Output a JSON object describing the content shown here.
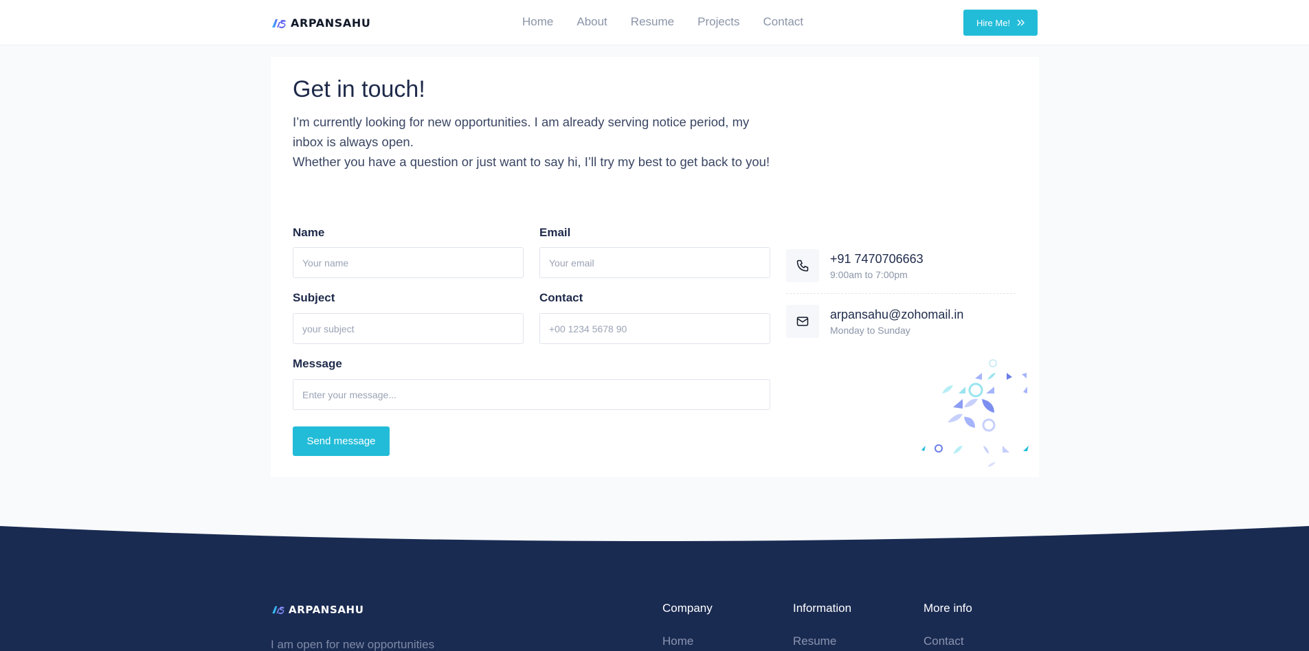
{
  "navbar": {
    "brand": "ARPANSAHU",
    "links": [
      "Home",
      "About",
      "Resume",
      "Projects",
      "Contact"
    ],
    "hire_label": "Hire Me!"
  },
  "contact": {
    "heading": "Get in touch!",
    "intro_line1": "I’m currently looking for new opportunities. I am already serving notice period, my inbox is always open.",
    "intro_line2": "Whether you have a question or just want to say hi, I’ll try my best to get back to you!",
    "form": {
      "name_label": "Name",
      "name_placeholder": "Your name",
      "email_label": "Email",
      "email_placeholder": "Your email",
      "subject_label": "Subject",
      "subject_placeholder": "your subject",
      "contact_label": "Contact",
      "contact_placeholder": "+00 1234 5678 90",
      "message_label": "Message",
      "message_placeholder": "Enter your message...",
      "send_label": "Send message"
    },
    "phone": {
      "value": "+91 7470706663",
      "hours": "9:00am to 7:00pm",
      "icon": "phone-icon"
    },
    "email": {
      "value": "arpansahu@zohomail.in",
      "days": "Monday to Sunday",
      "icon": "mail-icon"
    }
  },
  "footer": {
    "brand": "ARPANSAHU",
    "tagline": "I am open for new opportunities",
    "columns": [
      {
        "title": "Company",
        "first_link": "Home"
      },
      {
        "title": "Information",
        "first_link": "Resume"
      },
      {
        "title": "More info",
        "first_link": "Contact"
      }
    ]
  },
  "colors": {
    "accent": "#22bcd8",
    "footer_bg": "#1a2b52",
    "heading_text": "#1e2a4a",
    "muted_text": "#8a94a8"
  }
}
